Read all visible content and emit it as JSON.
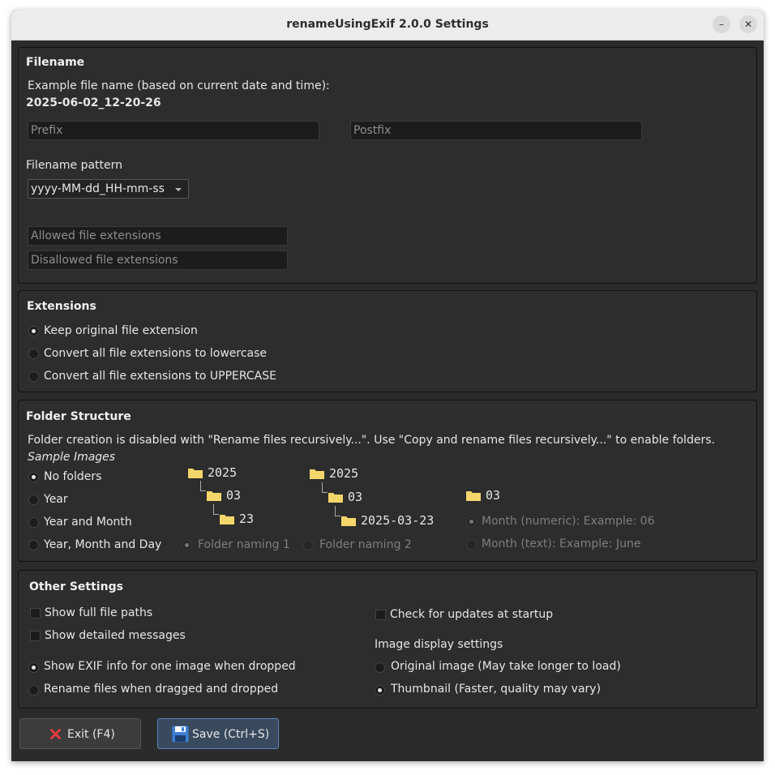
{
  "window": {
    "title": "renameUsingExif 2.0.0 Settings"
  },
  "filename": {
    "title": "Filename",
    "example_label": "Example file name (based on current date and time):",
    "example_value": "2025-06-02_12-20-26",
    "prefix_placeholder": "Prefix",
    "postfix_placeholder": "Postfix",
    "pattern_label": "Filename pattern",
    "pattern_value": "yyyy-MM-dd_HH-mm-ss",
    "allowed_placeholder": "Allowed file extensions",
    "disallowed_placeholder": "Disallowed file extensions"
  },
  "extensions": {
    "title": "Extensions",
    "options": [
      "Keep original file extension",
      "Convert all file extensions to lowercase",
      "Convert all file extensions to UPPERCASE"
    ],
    "selected": 0
  },
  "folders": {
    "title": "Folder Structure",
    "notice": "Folder creation is disabled with \"Rename files recursively...\". Use \"Copy and rename files recursively...\" to enable folders.",
    "sample_label": "Sample Images",
    "options": [
      "No folders",
      "Year",
      "Year and Month",
      "Year, Month and Day"
    ],
    "selected": 0,
    "naming1": {
      "year": "2025",
      "month": "03",
      "day": "23",
      "label": "Folder naming 1"
    },
    "naming2": {
      "year": "2025",
      "month": "03",
      "day": "2025-03-23",
      "label": "Folder naming 2"
    },
    "month_folder": "03",
    "month_numeric": "Month (numeric): Example: 06",
    "month_text": "Month (text): Example: June"
  },
  "other": {
    "title": "Other Settings",
    "show_full_paths": "Show full file paths",
    "show_detailed": "Show detailed messages",
    "check_updates": "Check for updates at startup",
    "image_display_label": "Image display settings",
    "show_exif": "Show EXIF info for one image when dropped",
    "rename_dragged": "Rename files when dragged and dropped",
    "original_image": "Original image (May take longer to load)",
    "thumbnail": "Thumbnail (Faster, quality may vary)"
  },
  "buttons": {
    "exit": "Exit (F4)",
    "save": "Save (Ctrl+S)"
  },
  "colors": {
    "folder": "#f5d66b",
    "exit_icon": "#e33b3b",
    "save_icon": "#3c7fd6"
  }
}
